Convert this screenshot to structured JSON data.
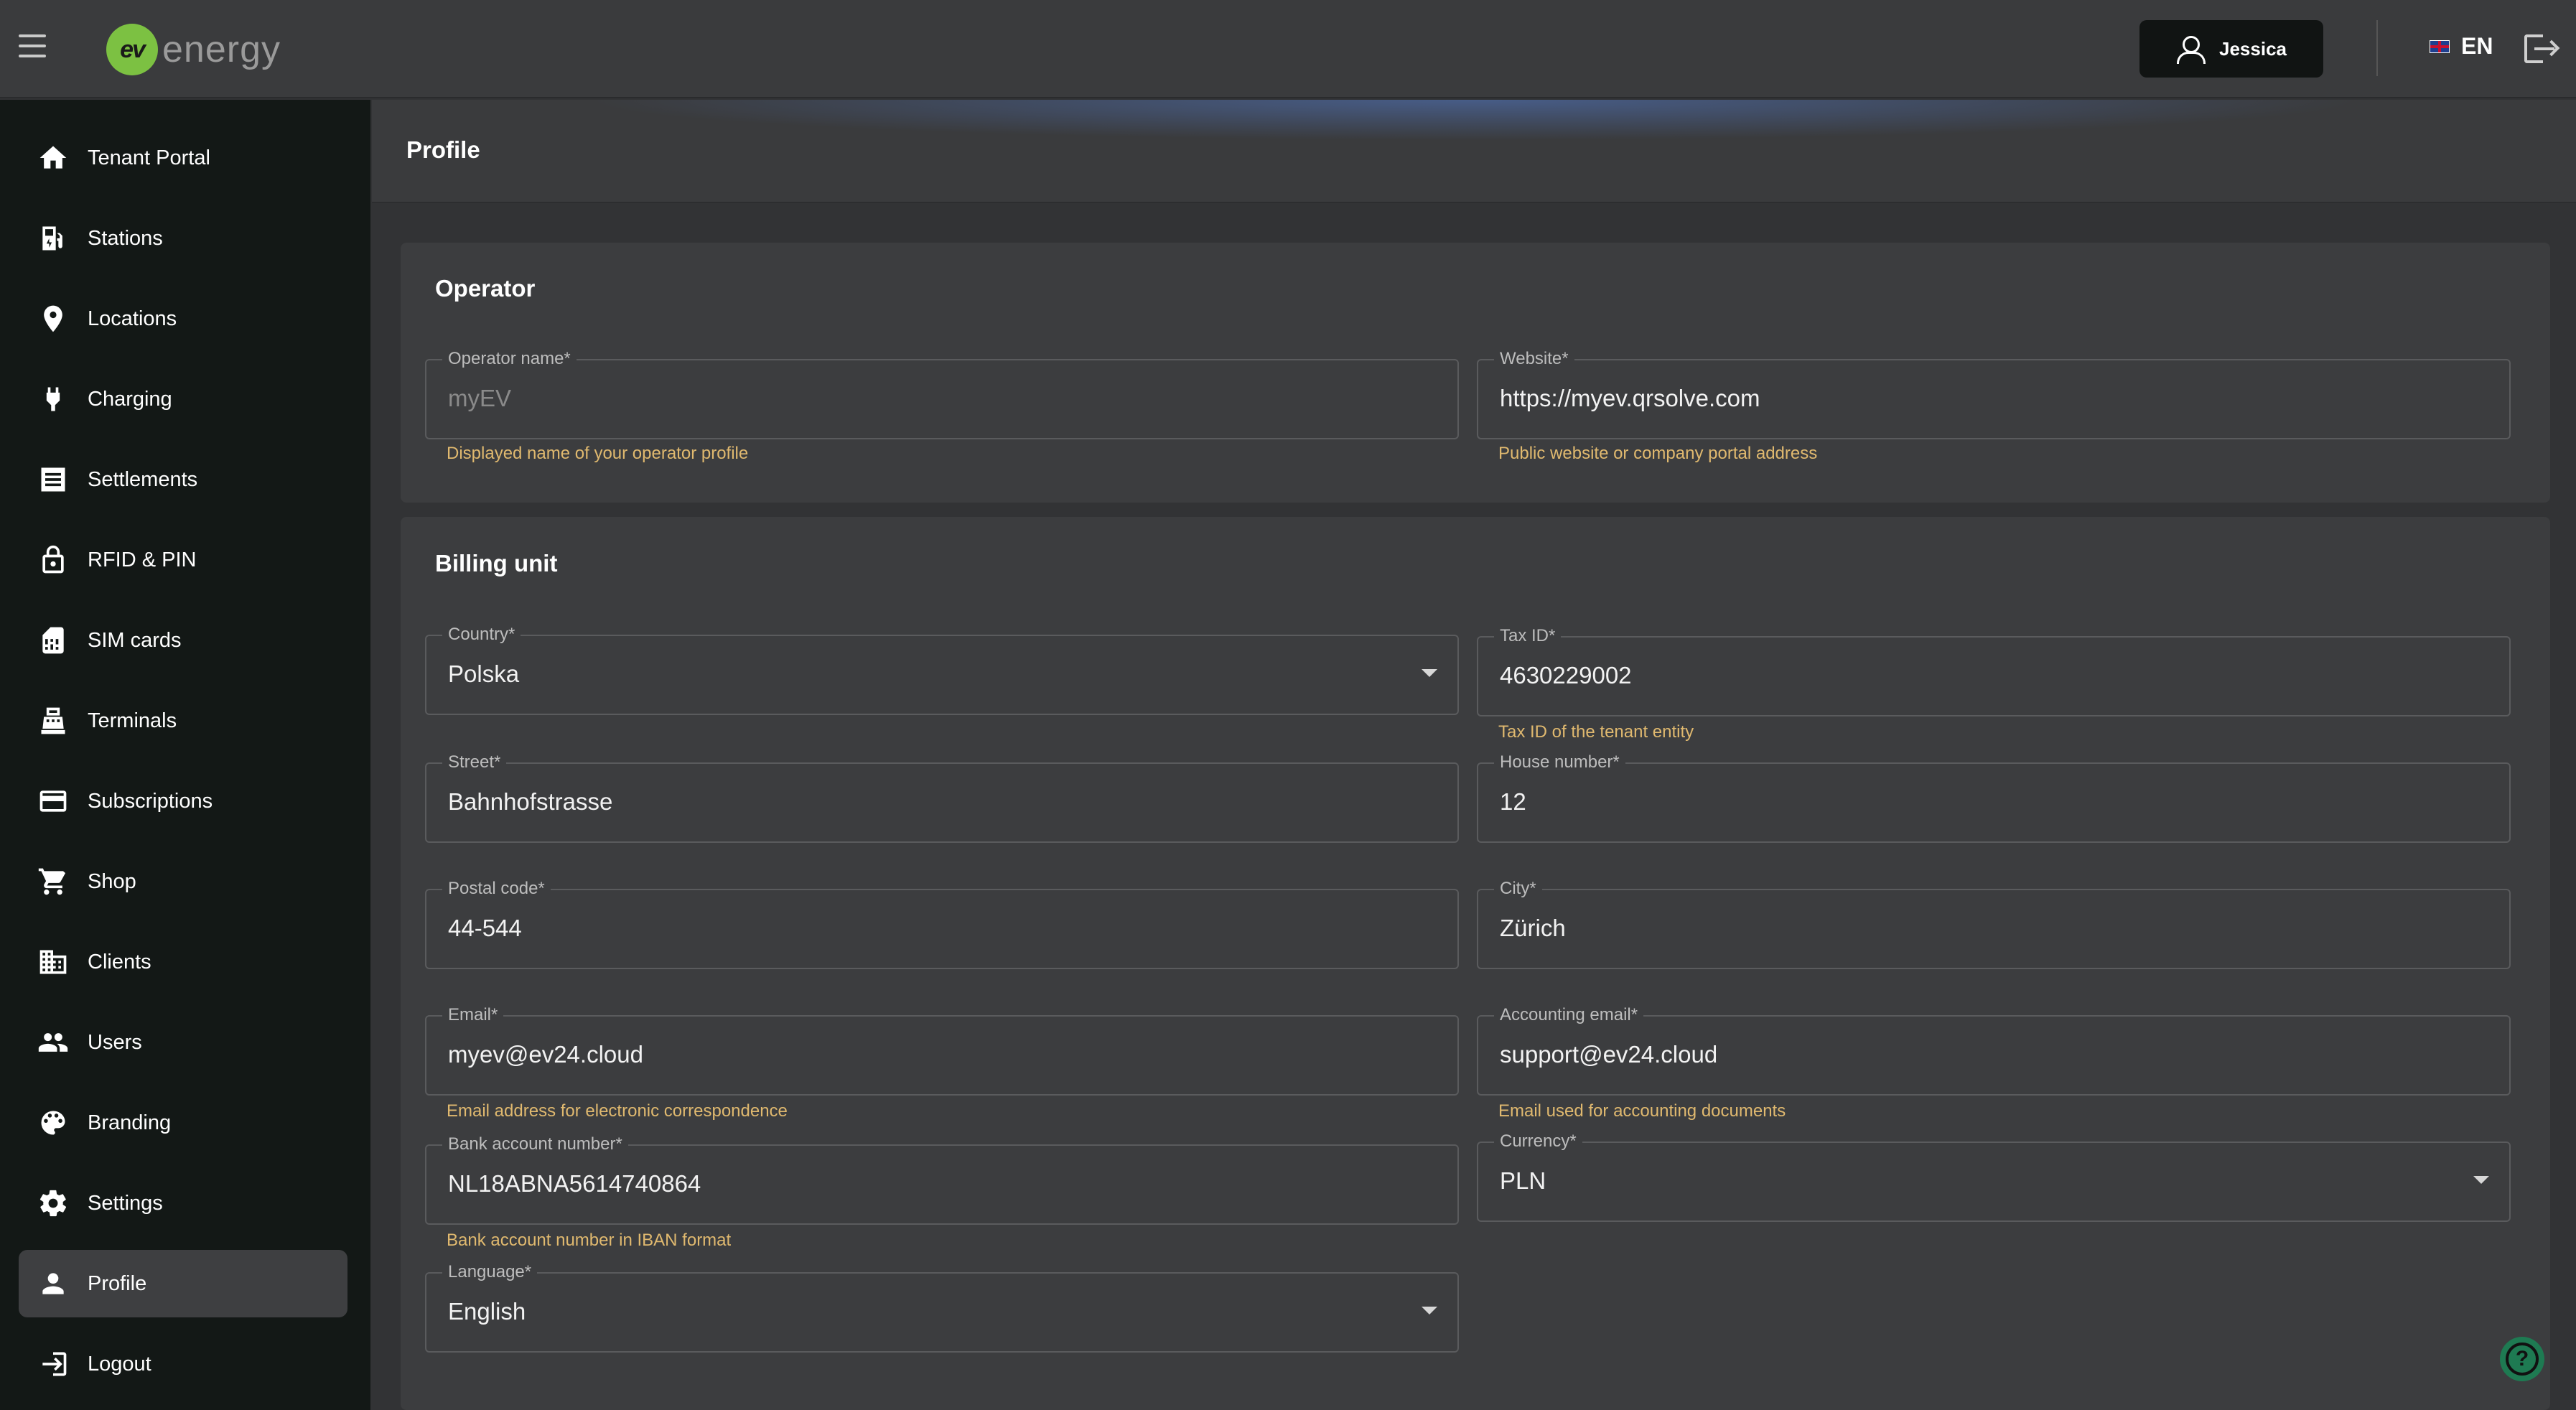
{
  "app": {
    "logo_mark": "ev",
    "logo_word": "energy",
    "user_name": "Jessica",
    "language": "EN"
  },
  "sidebar": {
    "items": [
      {
        "label": "Tenant Portal",
        "icon": "home-icon"
      },
      {
        "label": "Stations",
        "icon": "ev-station-icon"
      },
      {
        "label": "Locations",
        "icon": "location-pin-icon"
      },
      {
        "label": "Charging",
        "icon": "plug-icon"
      },
      {
        "label": "Settlements",
        "icon": "receipt-icon"
      },
      {
        "label": "RFID & PIN",
        "icon": "lock-icon"
      },
      {
        "label": "SIM cards",
        "icon": "sim-card-icon"
      },
      {
        "label": "Terminals",
        "icon": "terminal-icon"
      },
      {
        "label": "Subscriptions",
        "icon": "credit-card-icon"
      },
      {
        "label": "Shop",
        "icon": "cart-icon"
      },
      {
        "label": "Clients",
        "icon": "building-icon"
      },
      {
        "label": "Users",
        "icon": "users-icon"
      },
      {
        "label": "Branding",
        "icon": "palette-icon"
      },
      {
        "label": "Settings",
        "icon": "gear-icon"
      },
      {
        "label": "Profile",
        "icon": "person-icon",
        "active": true
      },
      {
        "label": "Logout",
        "icon": "logout-icon"
      }
    ]
  },
  "page": {
    "title": "Profile"
  },
  "operator": {
    "title": "Operator",
    "operator_name": {
      "label": "Operator name*",
      "value": "myEV",
      "helper": "Displayed name of your operator profile"
    },
    "website": {
      "label": "Website*",
      "value": "https://myev.qrsolve.com",
      "helper": "Public website or company portal address"
    }
  },
  "billing": {
    "title": "Billing unit",
    "country": {
      "label": "Country*",
      "value": "Polska"
    },
    "tax_id": {
      "label": "Tax ID*",
      "value": "4630229002",
      "helper": "Tax ID of the tenant entity"
    },
    "street": {
      "label": "Street*",
      "value": "Bahnhofstrasse"
    },
    "house_number": {
      "label": "House number*",
      "value": "12"
    },
    "postal_code": {
      "label": "Postal code*",
      "value": "44-544"
    },
    "city": {
      "label": "City*",
      "value": "Zürich"
    },
    "email": {
      "label": "Email*",
      "value": "myev@ev24.cloud",
      "helper": "Email address for electronic correspondence"
    },
    "accounting_email": {
      "label": "Accounting email*",
      "value": "support@ev24.cloud",
      "helper": "Email used for accounting documents"
    },
    "bank_account": {
      "label": "Bank account number*",
      "value": "NL18ABNA5614740864",
      "helper": "Bank account number in IBAN format"
    },
    "currency": {
      "label": "Currency*",
      "value": "PLN"
    },
    "language": {
      "label": "Language*",
      "value": "English"
    }
  },
  "help": {
    "symbol": "?"
  },
  "colors": {
    "accent_logo": "#7cc142",
    "helper_text": "#e0b96f",
    "sidebar_bg": "#131816",
    "help_button": "#1e7a52"
  }
}
